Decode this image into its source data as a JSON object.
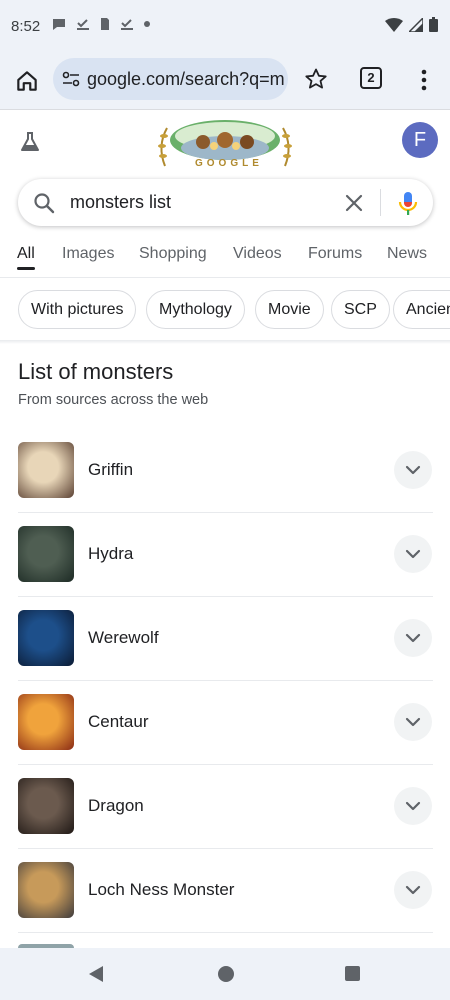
{
  "status_bar": {
    "time": "8:52"
  },
  "toolbar": {
    "url": "google.com/search?q=m",
    "tab_count": "2"
  },
  "account": {
    "initial": "F"
  },
  "doodle": {
    "text": "GOOGLE"
  },
  "search": {
    "query": "monsters list"
  },
  "tabs": [
    {
      "label": "All"
    },
    {
      "label": "Images"
    },
    {
      "label": "Shopping"
    },
    {
      "label": "Videos"
    },
    {
      "label": "Forums"
    },
    {
      "label": "News"
    }
  ],
  "chips": [
    {
      "label": "With pictures"
    },
    {
      "label": "Mythology"
    },
    {
      "label": "Movie"
    },
    {
      "label": "SCP"
    },
    {
      "label": "Ancient"
    }
  ],
  "list": {
    "title": "List of monsters",
    "subtitle": "From sources across the web",
    "items": [
      {
        "name": "Griffin",
        "thumb_colors": [
          "#e8d6b8",
          "#5a4032"
        ]
      },
      {
        "name": "Hydra",
        "thumb_colors": [
          "#4f5e52",
          "#1c2a24"
        ]
      },
      {
        "name": "Werewolf",
        "thumb_colors": [
          "#1d4f8a",
          "#0b1a33"
        ]
      },
      {
        "name": "Centaur",
        "thumb_colors": [
          "#f0a33c",
          "#8a2a14"
        ]
      },
      {
        "name": "Dragon",
        "thumb_colors": [
          "#6b5a4e",
          "#1e1714"
        ]
      },
      {
        "name": "Loch Ness Monster",
        "thumb_colors": [
          "#c79a5a",
          "#3d3a3c"
        ]
      }
    ]
  },
  "colors": {
    "accent_blue": "#1a73e8",
    "avatar": "#5c6bc0",
    "toolbar_bg": "#eef2f8"
  }
}
